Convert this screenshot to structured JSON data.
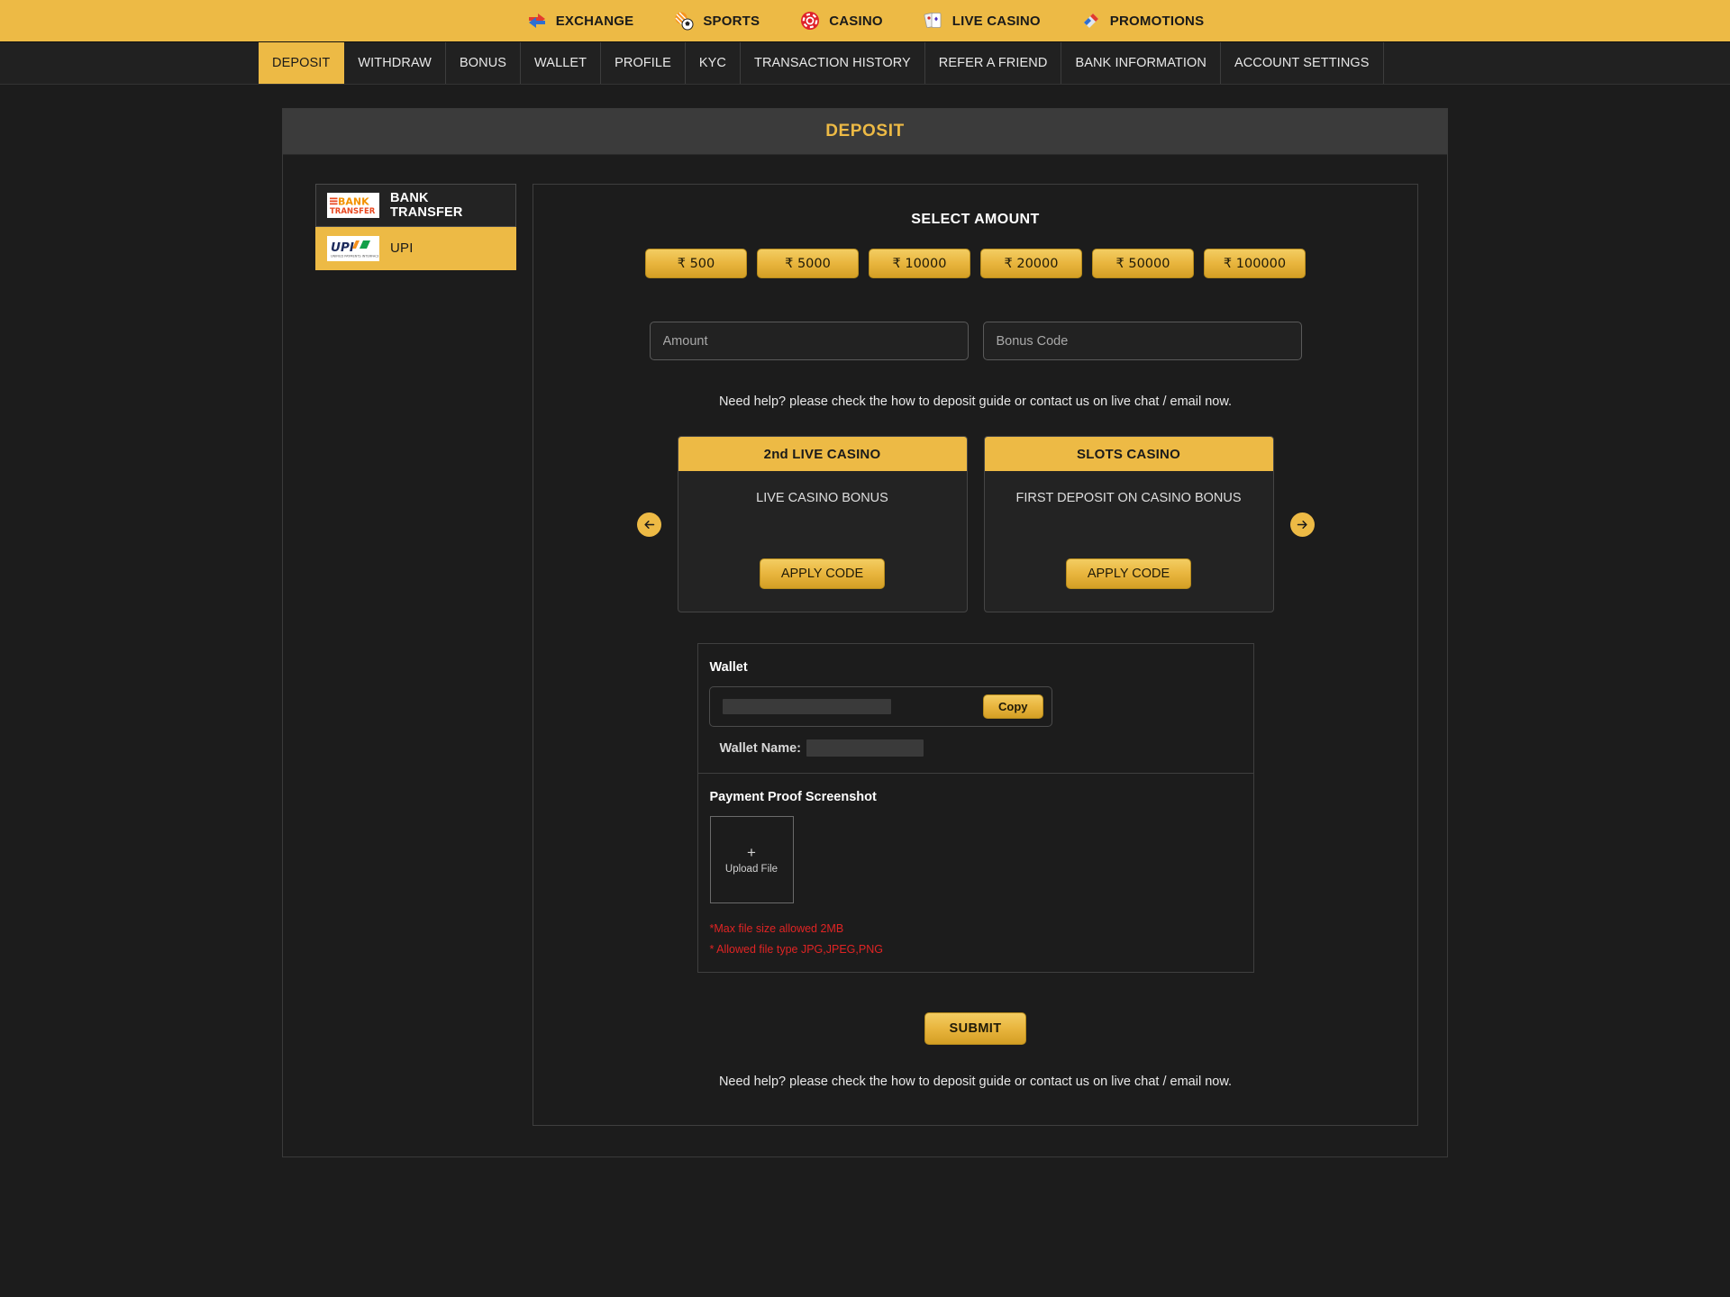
{
  "topbar": {
    "items": [
      {
        "label": "EXCHANGE",
        "icon": "exchange-arrows-icon"
      },
      {
        "label": "SPORTS",
        "icon": "sports-ball-icon"
      },
      {
        "label": "CASINO",
        "icon": "casino-chip-icon"
      },
      {
        "label": "LIVE CASINO",
        "icon": "playing-cards-icon"
      },
      {
        "label": "PROMOTIONS",
        "icon": "promotions-megaphone-icon"
      }
    ]
  },
  "nav": {
    "tabs": [
      {
        "label": "DEPOSIT",
        "active": true
      },
      {
        "label": "WITHDRAW",
        "active": false
      },
      {
        "label": "BONUS",
        "active": false
      },
      {
        "label": "WALLET",
        "active": false
      },
      {
        "label": "PROFILE",
        "active": false
      },
      {
        "label": "KYC",
        "active": false
      },
      {
        "label": "TRANSACTION HISTORY",
        "active": false
      },
      {
        "label": "REFER A FRIEND",
        "active": false
      },
      {
        "label": "BANK INFORMATION",
        "active": false
      },
      {
        "label": "ACCOUNT SETTINGS",
        "active": false
      }
    ]
  },
  "panel": {
    "title": "DEPOSIT"
  },
  "sidebar": {
    "items": [
      {
        "label": "BANK TRANSFER",
        "logo": "bank-transfer-logo",
        "active": false
      },
      {
        "label": "UPI",
        "logo": "upi-logo",
        "active": true
      }
    ]
  },
  "form": {
    "select_amount_title": "SELECT AMOUNT",
    "currency_symbol": "₹",
    "amounts": [
      {
        "label": "₹ 500",
        "value": 500
      },
      {
        "label": "₹ 5000",
        "value": 5000
      },
      {
        "label": "₹ 10000",
        "value": 10000
      },
      {
        "label": "₹ 20000",
        "value": 20000
      },
      {
        "label": "₹ 50000",
        "value": 50000
      },
      {
        "label": "₹ 100000",
        "value": 100000
      }
    ],
    "amount_input": {
      "placeholder": "Amount",
      "value": ""
    },
    "bonus_input": {
      "placeholder": "Bonus Code",
      "value": ""
    },
    "help_text": "Need help? please check the how to deposit guide or contact us on live chat / email now.",
    "footer_help_text": "Need help? please check the how to deposit guide or contact us on live chat / email now.",
    "submit_label": "SUBMIT"
  },
  "carousel": {
    "prev_icon": "arrow-left-icon",
    "next_icon": "arrow-right-icon",
    "cards": [
      {
        "title": "2nd LIVE CASINO",
        "description": "LIVE CASINO BONUS",
        "button_label": "APPLY CODE"
      },
      {
        "title": "SLOTS CASINO",
        "description": "FIRST DEPOSIT ON CASINO BONUS",
        "button_label": "APPLY CODE"
      }
    ]
  },
  "wallet": {
    "title": "Wallet",
    "address_value": "",
    "address_redacted": true,
    "copy_label": "Copy",
    "name_label": "Wallet Name:",
    "name_value": "",
    "name_redacted": true
  },
  "payment_proof": {
    "title": "Payment Proof Screenshot",
    "upload_plus": "+",
    "upload_label": "Upload File",
    "warning_size": "*Max file size allowed 2MB",
    "warning_type": "* Allowed file type JPG,JPEG,PNG"
  },
  "colors": {
    "accent_yellow": "#edba45",
    "page_background": "#1c1c1c",
    "panel_header": "#3b3b3b",
    "warning_red": "#e02424",
    "text_light": "#e9e9e9"
  }
}
